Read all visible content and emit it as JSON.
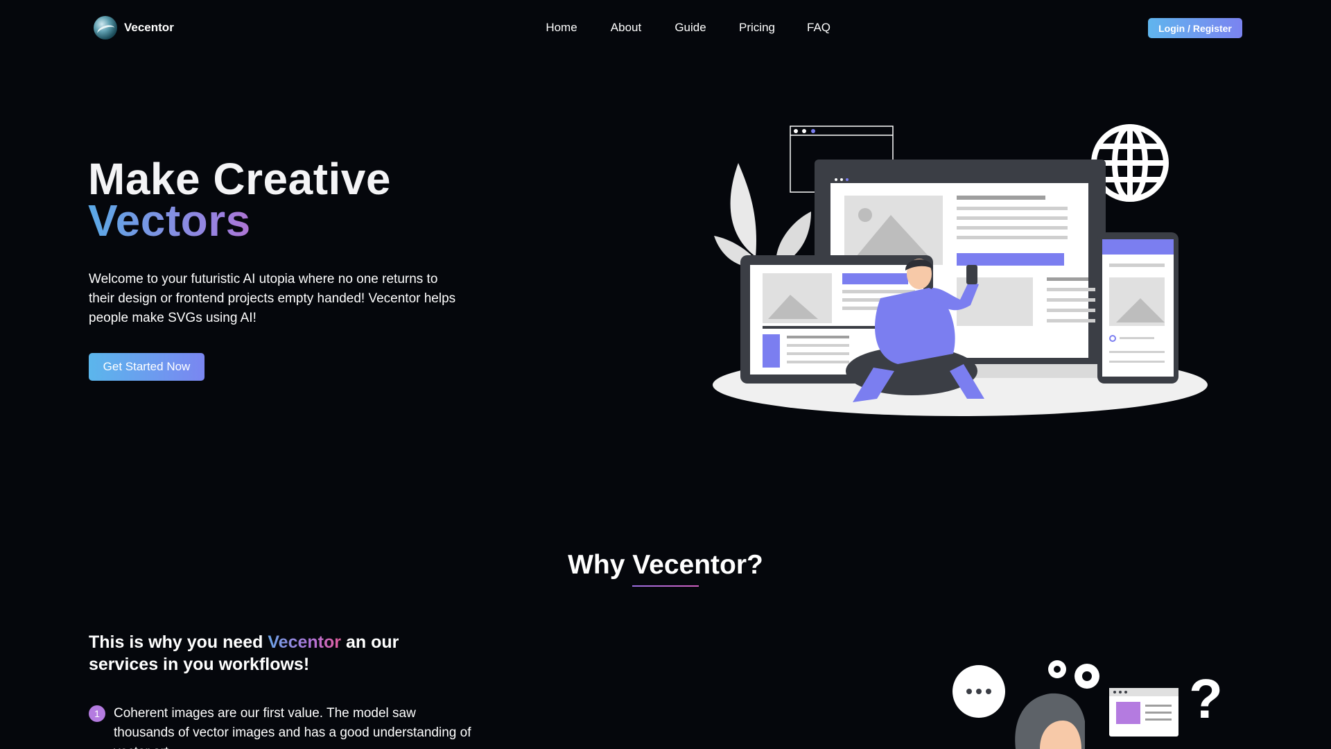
{
  "brand": {
    "name": "Vecentor",
    "logo_icon": "globe-wave-icon"
  },
  "nav": {
    "items": [
      {
        "label": "Home"
      },
      {
        "label": "About"
      },
      {
        "label": "Guide"
      },
      {
        "label": "Pricing"
      },
      {
        "label": "FAQ"
      }
    ],
    "login_label": "Login / Register"
  },
  "hero": {
    "title_line1": "Make Creative",
    "title_line2": "Vectors",
    "description": "Welcome to your futuristic AI utopia where no one returns to their design or frontend projects empty handed! Vecentor helps people make SVGs using AI!",
    "cta_label": "Get Started Now",
    "illustration": "person-with-devices-illustration"
  },
  "why": {
    "heading": "Why Vecentor?",
    "subtitle_before": "This is why you need ",
    "subtitle_accent": "Vecentor",
    "subtitle_after": " an our services in you workflows!",
    "reasons": [
      {
        "number": "1",
        "text": "Coherent images are our first value. The model saw thousands of vector images and has a good understanding of vector art."
      }
    ],
    "illustration": "confused-person-chat-gears-illustration"
  },
  "colors": {
    "background": "#05070c",
    "accent_blue": "#5bb6ec",
    "accent_purple": "#7b83f0",
    "accent_pink": "#d262b8",
    "number_badge": "#b47be0"
  }
}
